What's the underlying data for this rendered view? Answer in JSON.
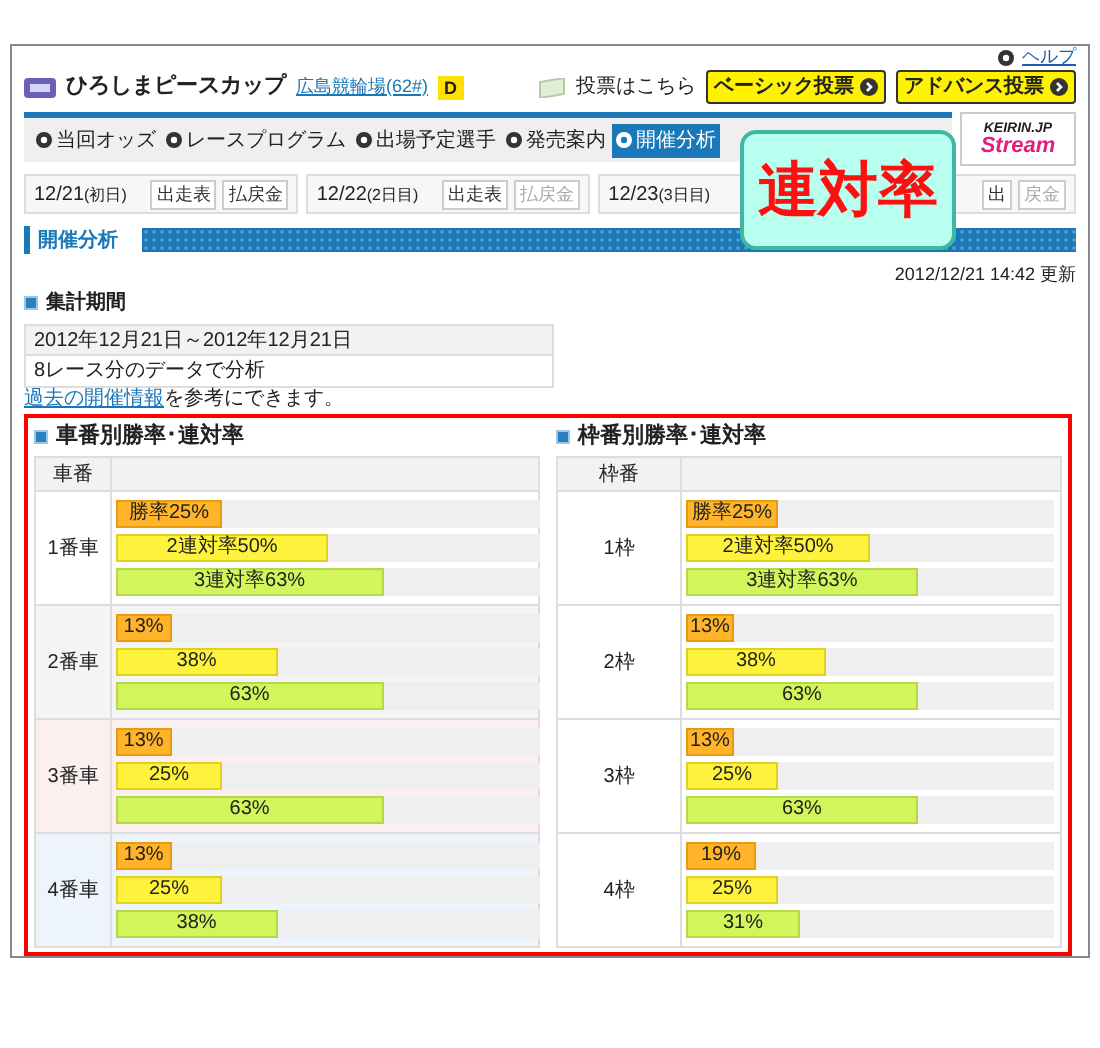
{
  "help_link": "ヘルプ",
  "header": {
    "title": "ひろしまピースカップ",
    "venue_link": "広島競輪場(62#)",
    "badge": "D",
    "vote_label": "投票はこちら",
    "buttons": [
      "ベーシック投票",
      "アドバンス投票"
    ]
  },
  "nav": [
    {
      "label": "当回オッズ",
      "selected": false
    },
    {
      "label": "レースプログラム",
      "selected": false
    },
    {
      "label": "出場予定選手",
      "selected": false
    },
    {
      "label": "発売案内",
      "selected": false
    },
    {
      "label": "開催分析",
      "selected": true
    }
  ],
  "stream_logo": {
    "top": "KEIRIN.JP",
    "bottom": "Stream"
  },
  "days": [
    {
      "date": "12/21",
      "day": "(初日)",
      "buttons": [
        {
          "label": "出走表",
          "disabled": false
        },
        {
          "label": "払戻金",
          "disabled": false
        }
      ]
    },
    {
      "date": "12/22",
      "day": "(2日目)",
      "buttons": [
        {
          "label": "出走表",
          "disabled": false
        },
        {
          "label": "払戻金",
          "disabled": true
        }
      ]
    },
    {
      "date": "12/23",
      "day": "(3日目)",
      "buttons": [
        {
          "label": "出",
          "disabled": false
        },
        {
          "label": "戻金",
          "disabled": true
        }
      ]
    }
  ],
  "callout": "連対率",
  "section_title": "開催分析",
  "updated": "2012/12/21 14:42 更新",
  "period": {
    "heading": "集計期間",
    "rows": [
      "2012年12月21日～2012年12月21日",
      "8レース分のデータで分析"
    ],
    "link": "過去の開催情報",
    "note": "を参考にできます。"
  },
  "panels": [
    {
      "title": "車番別勝率･連対率",
      "column": "車番",
      "rows": [
        {
          "label": "1番車",
          "color": "#ffffff",
          "bars": [
            {
              "kind": "win",
              "text": "勝率25%",
              "level": 0.25
            },
            {
              "kind": "second",
              "text": "2連対率50%",
              "level": 0.5
            },
            {
              "kind": "third",
              "text": "3連対率63%",
              "level": 0.63
            }
          ]
        },
        {
          "label": "2番車",
          "color": "#f4f4f4",
          "bars": [
            {
              "kind": "win",
              "text": "13%",
              "level": 0.13
            },
            {
              "kind": "second",
              "text": "38%",
              "level": 0.38
            },
            {
              "kind": "third",
              "text": "63%",
              "level": 0.63
            }
          ]
        },
        {
          "label": "3番車",
          "color": "#fcefef",
          "bars": [
            {
              "kind": "win",
              "text": "13%",
              "level": 0.13
            },
            {
              "kind": "second",
              "text": "25%",
              "level": 0.25
            },
            {
              "kind": "third",
              "text": "63%",
              "level": 0.63
            }
          ]
        },
        {
          "label": "4番車",
          "color": "#eef4fb",
          "bars": [
            {
              "kind": "win",
              "text": "13%",
              "level": 0.13
            },
            {
              "kind": "second",
              "text": "25%",
              "level": 0.25
            },
            {
              "kind": "third",
              "text": "38%",
              "level": 0.38
            }
          ]
        }
      ]
    },
    {
      "title": "枠番別勝率･連対率",
      "column": "枠番",
      "rows": [
        {
          "label": "1枠",
          "bars": [
            {
              "kind": "win",
              "text": "勝率25%",
              "level": 0.25
            },
            {
              "kind": "second",
              "text": "2連対率50%",
              "level": 0.5
            },
            {
              "kind": "third",
              "text": "3連対率63%",
              "level": 0.63
            }
          ]
        },
        {
          "label": "2枠",
          "bars": [
            {
              "kind": "win",
              "text": "13%",
              "level": 0.13
            },
            {
              "kind": "second",
              "text": "38%",
              "level": 0.38
            },
            {
              "kind": "third",
              "text": "63%",
              "level": 0.63
            }
          ]
        },
        {
          "label": "3枠",
          "bars": [
            {
              "kind": "win",
              "text": "13%",
              "level": 0.13
            },
            {
              "kind": "second",
              "text": "25%",
              "level": 0.25
            },
            {
              "kind": "third",
              "text": "63%",
              "level": 0.63
            }
          ]
        },
        {
          "label": "4枠",
          "bars": [
            {
              "kind": "win",
              "text": "19%",
              "level": 0.19
            },
            {
              "kind": "second",
              "text": "25%",
              "level": 0.25
            },
            {
              "kind": "third",
              "text": "31%",
              "level": 0.31
            }
          ]
        }
      ]
    }
  ]
}
